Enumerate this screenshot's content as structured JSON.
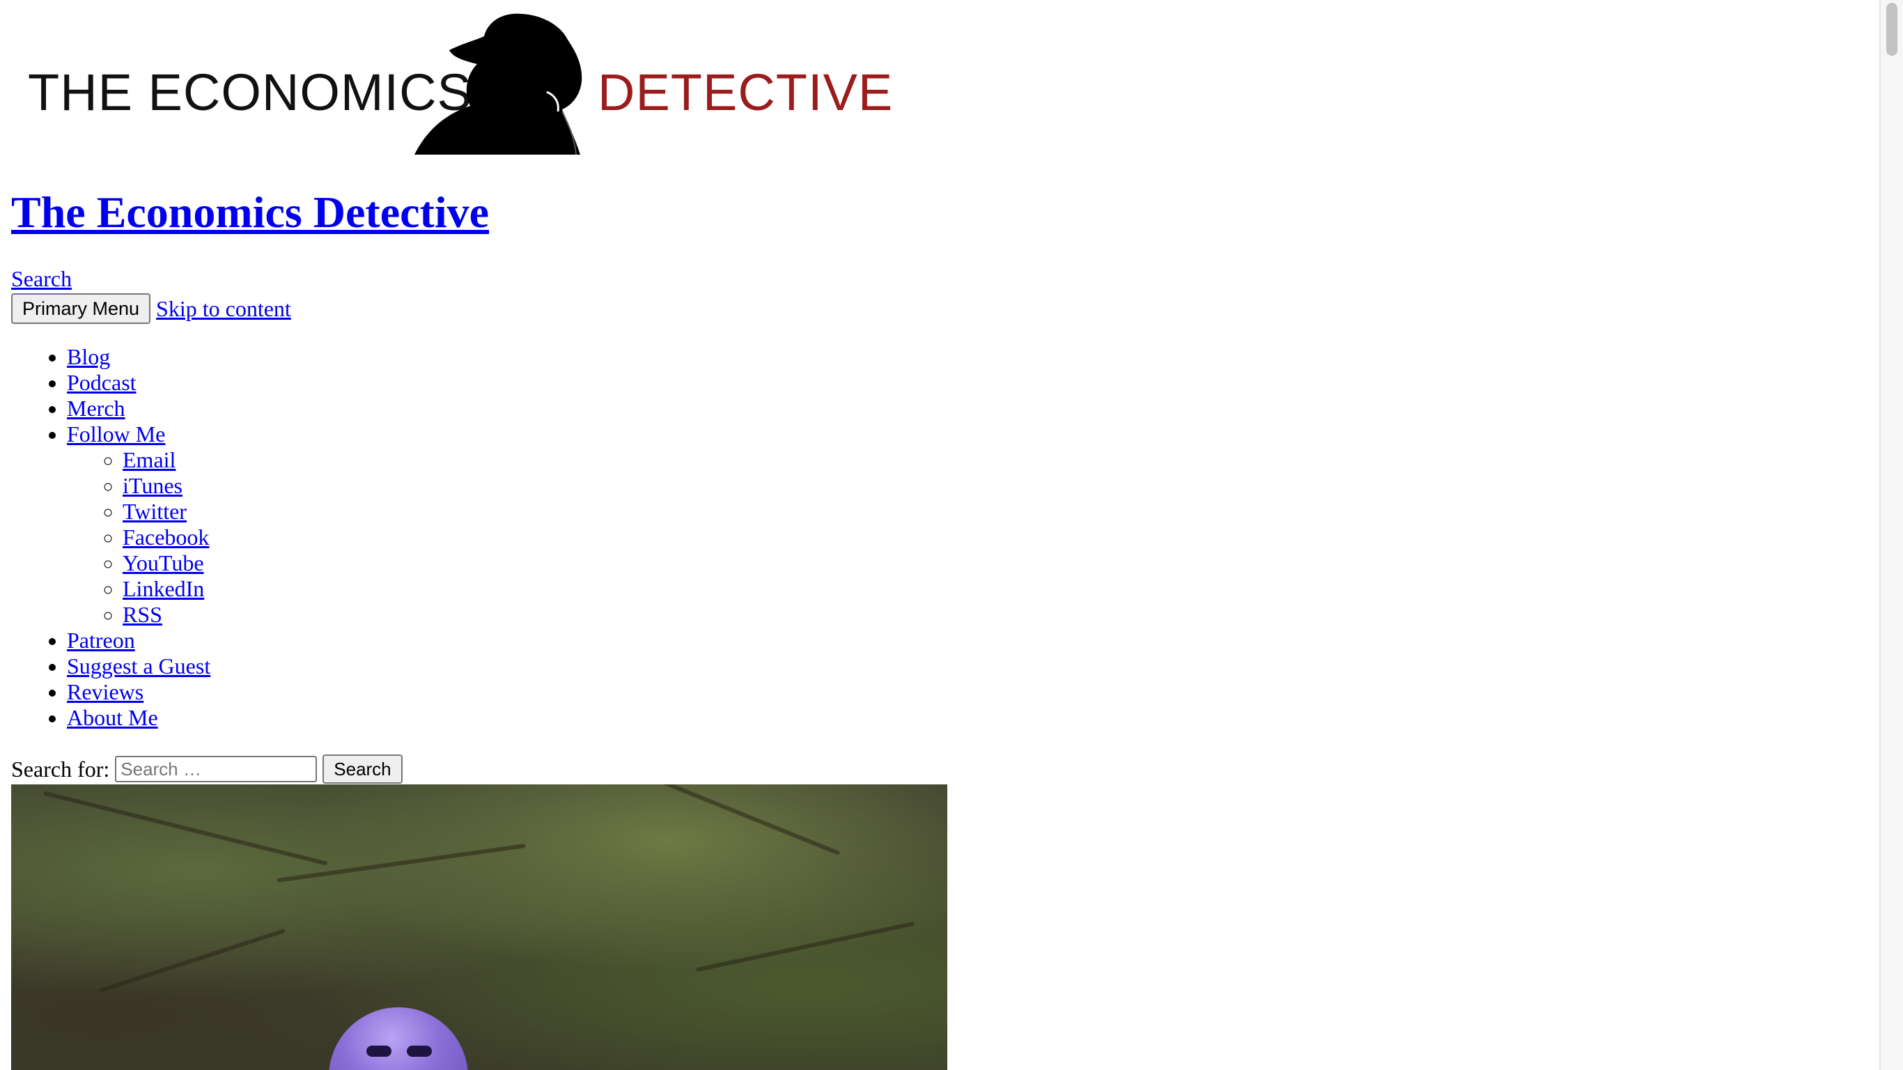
{
  "header": {
    "logo": {
      "word1": "THE ECONOMICS",
      "word2": "DETECTIVE",
      "brand_dark": "#111111",
      "brand_red": "#9b1c1c",
      "icon": "detective-silhouette-icon"
    },
    "site_title": "The Economics Detective",
    "search_link": "Search",
    "primary_menu_label": "Primary Menu",
    "skip_link": "Skip to content"
  },
  "nav": {
    "items": [
      {
        "label": "Blog"
      },
      {
        "label": "Podcast"
      },
      {
        "label": "Merch"
      },
      {
        "label": "Follow Me",
        "children": [
          {
            "label": "Email"
          },
          {
            "label": "iTunes"
          },
          {
            "label": "Twitter"
          },
          {
            "label": "Facebook"
          },
          {
            "label": "YouTube"
          },
          {
            "label": "LinkedIn"
          },
          {
            "label": "RSS"
          }
        ]
      },
      {
        "label": "Patreon"
      },
      {
        "label": "Suggest a Guest"
      },
      {
        "label": "Reviews"
      },
      {
        "label": "About Me"
      }
    ]
  },
  "search_form": {
    "label": "Search for:",
    "placeholder": "Search …",
    "value": "",
    "submit_label": "Search"
  },
  "colors": {
    "link": "#0000ee"
  }
}
